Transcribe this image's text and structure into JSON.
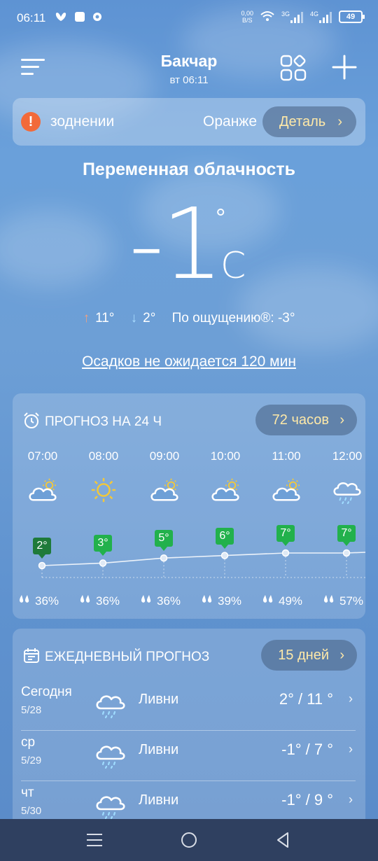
{
  "status_bar": {
    "time": "06:11",
    "net_speed_value": "0,00",
    "net_speed_unit": "B/S",
    "sim1": "3G",
    "sim2": "4G",
    "battery": "49"
  },
  "header": {
    "city": "Бакчар",
    "time": "вт 06:11"
  },
  "alert": {
    "text": "зоднении",
    "level": "Оранже",
    "button": "Деталь"
  },
  "current": {
    "condition": "Переменная облачность",
    "temperature": "-1",
    "degree": "°",
    "unit": "C",
    "high": "11°",
    "low": "2°",
    "feels_like": "По ощущению®: -3°",
    "precip_note": "Осадков не ожидается 120 мин"
  },
  "hourly": {
    "title": "ПРОГНОЗ НА 24 Ч",
    "button": "72 часов",
    "items": [
      {
        "time": "07:00",
        "icon": "partly-cloudy-icon",
        "temp": "2°",
        "rain": "36%"
      },
      {
        "time": "08:00",
        "icon": "sun-icon",
        "temp": "3°",
        "rain": "36%"
      },
      {
        "time": "09:00",
        "icon": "partly-cloudy-icon",
        "temp": "5°",
        "rain": "36%"
      },
      {
        "time": "10:00",
        "icon": "partly-cloudy-icon",
        "temp": "6°",
        "rain": "39%"
      },
      {
        "time": "11:00",
        "icon": "partly-cloudy-icon",
        "temp": "7°",
        "rain": "49%"
      },
      {
        "time": "12:00",
        "icon": "rain-cloud-icon",
        "temp": "7°",
        "rain": "57%"
      }
    ],
    "colors": {
      "first_flag": "#1f7a3a",
      "flag": "#22b14c"
    }
  },
  "daily": {
    "title": "ЕЖЕДНЕВНЫЙ ПРОГНОЗ",
    "button": "15 дней",
    "items": [
      {
        "day": "Сегодня",
        "date": "5/28",
        "cond": "Ливни",
        "temps": "2° / 11 °"
      },
      {
        "day": "ср",
        "date": "5/29",
        "cond": "Ливни",
        "temps": "-1° / 7 °"
      },
      {
        "day": "чт",
        "date": "5/30",
        "cond": "Ливни",
        "temps": "-1° / 9 °"
      }
    ]
  }
}
